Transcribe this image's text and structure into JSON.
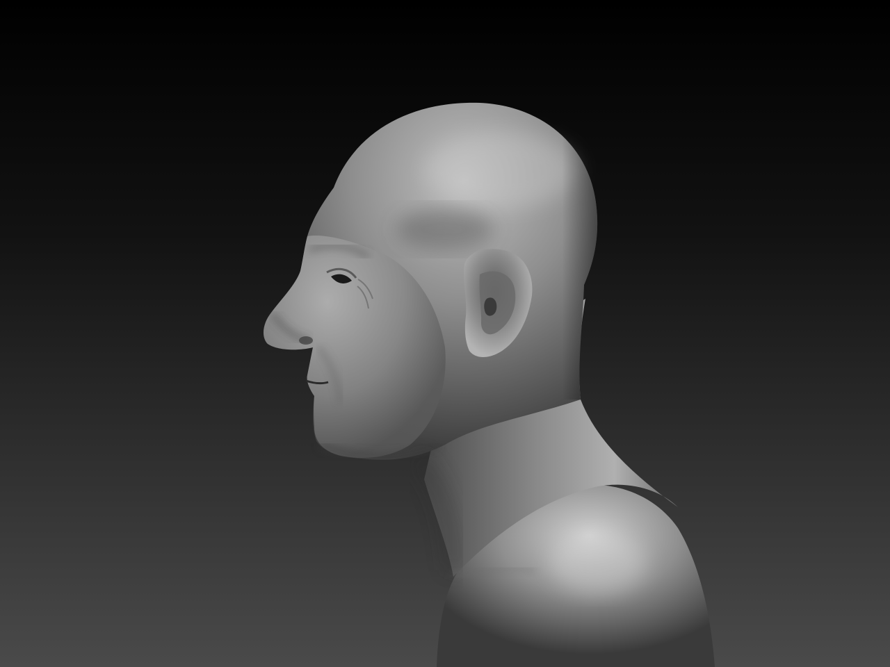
{
  "scene": {
    "subject": "sculpted-head-bust-profile",
    "material": "matte-clay",
    "colors": {
      "background_top": "#000000",
      "background_bottom": "#4a4a4a",
      "clay_shadow": "#2c2c2c",
      "clay_mid": "#7a7a7a",
      "clay_highlight": "#c4c4c4"
    }
  }
}
